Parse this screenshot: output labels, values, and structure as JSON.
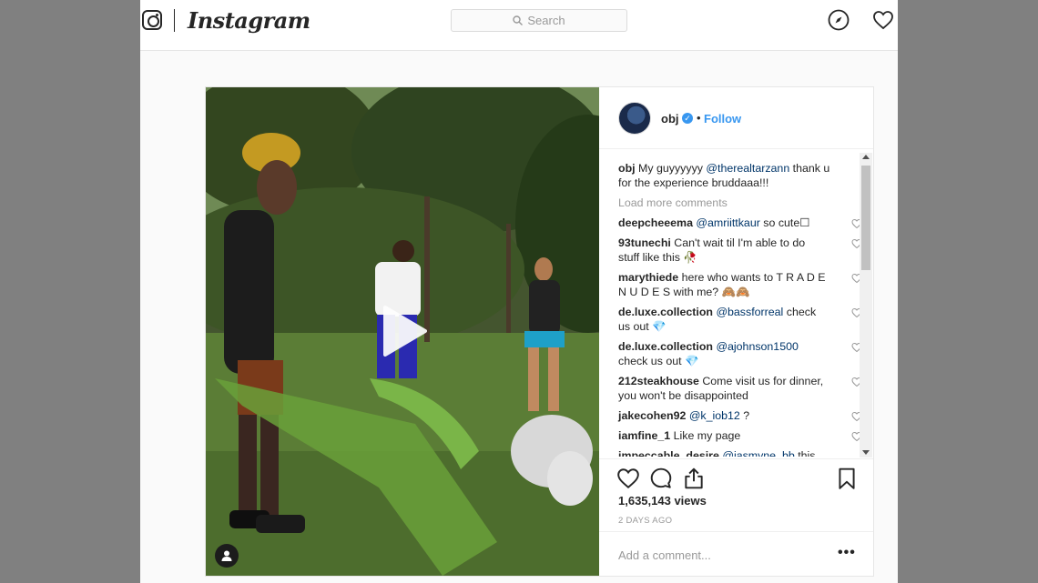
{
  "app": {
    "wordmark": "Instagram"
  },
  "search": {
    "placeholder": "Search"
  },
  "post": {
    "username": "obj",
    "follow_label": "Follow",
    "bullet": "•",
    "caption": {
      "user": "obj",
      "text": "My guyyyyyy",
      "mention": "@therealtarzann",
      "text2": "thank u for the experience bruddaaa!!!"
    },
    "load_more": "Load more comments",
    "comments": [
      {
        "user": "deepcheeema",
        "mention": "@amriittkaur",
        "text": "so cute☐"
      },
      {
        "user": "93tunechi",
        "mention": "",
        "text": "Can't wait til I'm able to do stuff like this 🥀"
      },
      {
        "user": "marythiede",
        "mention": "",
        "text": "here who wants to T R A D E N U D E S with me? 🙈🙈"
      },
      {
        "user": "de.luxe.collection",
        "mention": "@bassforreal",
        "text": "check us out 💎"
      },
      {
        "user": "de.luxe.collection",
        "mention": "@ajohnson1500",
        "text": "check us out 💎"
      },
      {
        "user": "212steakhouse",
        "mention": "",
        "text": "Come visit us for dinner, you won't be disappointed"
      },
      {
        "user": "jakecohen92",
        "mention": "@k_iob12",
        "text": "?"
      },
      {
        "user": "iamfine_1",
        "mention": "",
        "text": "Like my page"
      },
      {
        "user": "impeccable_desire",
        "mention": "@jasmyne_bb",
        "text": "this"
      }
    ],
    "views": "1,635,143 views",
    "time_ago": "2 DAYS AGO",
    "add_comment_placeholder": "Add a comment...",
    "more_options": "•••"
  },
  "colors": {
    "accent": "#3897f0",
    "mention": "#003569",
    "muted": "#999999"
  },
  "icons": [
    "instagram-glyph-icon",
    "search-icon",
    "compass-icon",
    "heart-icon",
    "play-icon",
    "user-tag-icon",
    "comment-icon",
    "share-icon",
    "bookmark-icon",
    "verified-badge-icon"
  ]
}
